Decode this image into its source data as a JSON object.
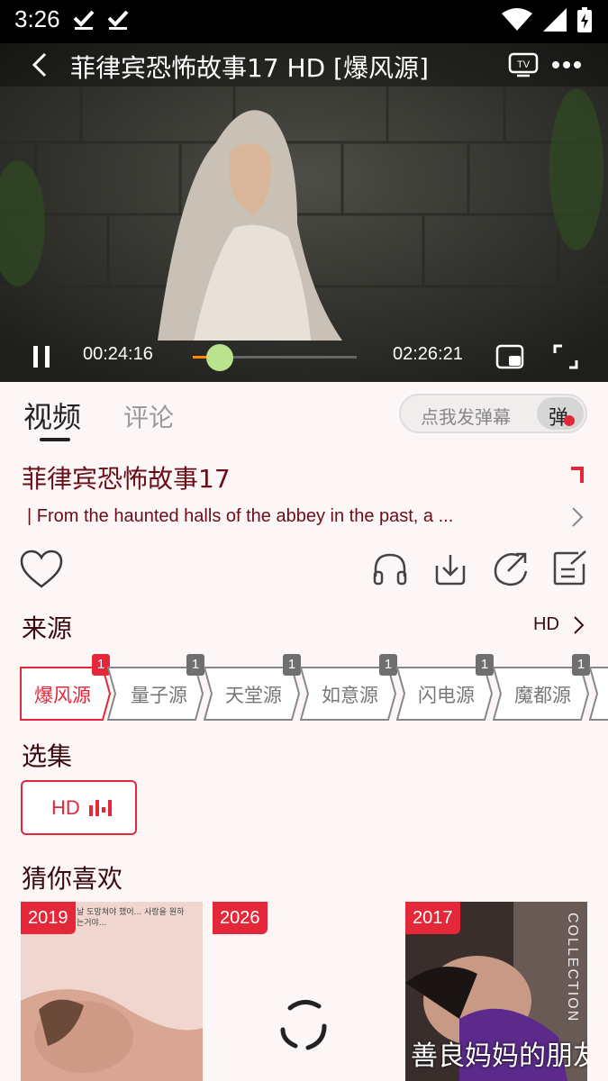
{
  "status": {
    "time": "3:26"
  },
  "player": {
    "title": "菲律宾恐怖故事17 HD [爆风源]",
    "current_time": "00:24:16",
    "total_time": "02:26:21",
    "progress": 0.166
  },
  "tabs": {
    "video": "视频",
    "comment": "评论"
  },
  "danmu": {
    "placeholder": "点我发弹幕",
    "toggle_label": "弹"
  },
  "info": {
    "title": "菲律宾恐怖故事17",
    "description": "| From the haunted halls of the abbey in the past, a ..."
  },
  "source": {
    "title": "来源",
    "quality": "HD",
    "items": [
      {
        "label": "爆风源",
        "badge": "1"
      },
      {
        "label": "量子源",
        "badge": "1"
      },
      {
        "label": "天堂源",
        "badge": "1"
      },
      {
        "label": "如意源",
        "badge": "1"
      },
      {
        "label": "闪电源",
        "badge": "1"
      },
      {
        "label": "魔都源",
        "badge": "1"
      }
    ]
  },
  "episodes": {
    "title": "选集",
    "items": [
      {
        "label": "HD"
      }
    ]
  },
  "recommend": {
    "title": "猜你喜欢",
    "items": [
      {
        "year": "2019",
        "poster_text": "날 도망쳐야 했어... 사랑을 원하는거야..."
      },
      {
        "year": "2026"
      },
      {
        "year": "2017",
        "caption": "善良妈妈的朋友",
        "side_text": "COLLECTION"
      }
    ]
  },
  "colors": {
    "accent": "#e5273a",
    "title_text": "#6b0d17",
    "background": "#fdf6f6"
  }
}
